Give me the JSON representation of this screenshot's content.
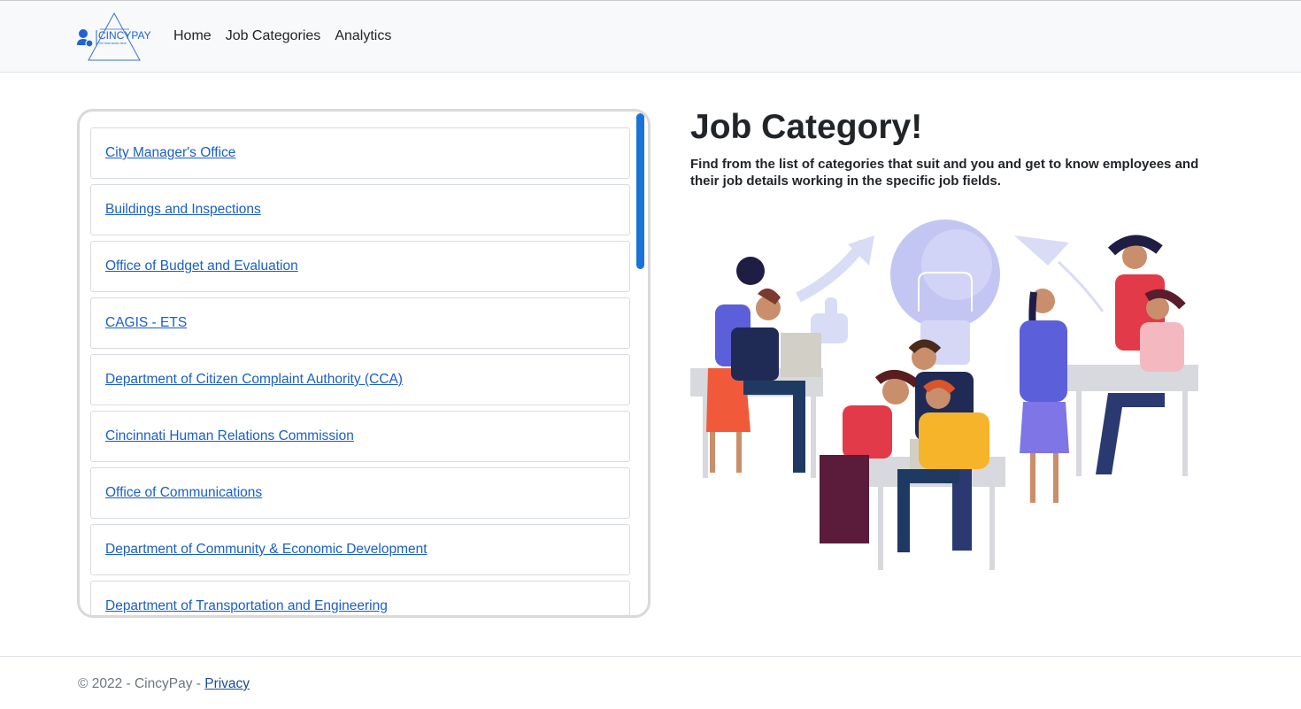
{
  "brand": {
    "name": "CINCYPAY",
    "tagline": "The best works here"
  },
  "nav": {
    "items": [
      "Home",
      "Job Categories",
      "Analytics"
    ]
  },
  "categories": [
    "City Manager's Office",
    "Buildings and Inspections",
    "Office of Budget and Evaluation",
    "CAGIS - ETS",
    "Department of Citizen Complaint Authority (CCA)",
    "Cincinnati Human Relations Commission",
    "Office of Communications",
    "Department of Community & Economic Development",
    "Department of Transportation and Engineering"
  ],
  "hero": {
    "title": "Job Category!",
    "description": "Find from the list of categories that suit and you and get to know employees and their job details working in the specific job fields."
  },
  "footer": {
    "copyright": "© 2022 - CincyPay - ",
    "privacy_label": "Privacy"
  },
  "colors": {
    "link": "#1a5fc4",
    "accent": "#1a73d8",
    "navbar_bg": "#f8f9fa"
  }
}
